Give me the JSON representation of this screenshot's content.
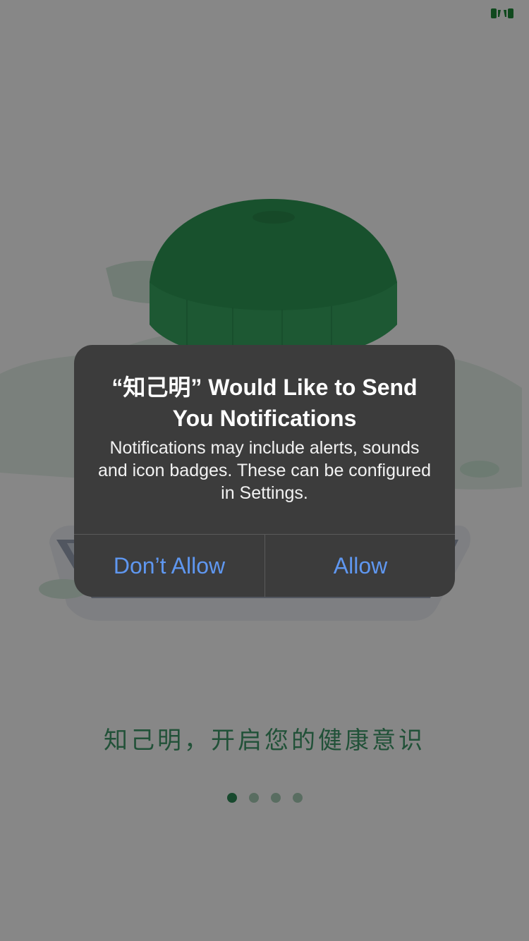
{
  "onboarding": {
    "tagline": "知己明，开启您的健康意识",
    "page_count": 4,
    "active_page": 1
  },
  "alert": {
    "title": "“知己明” Would Like to Send You Notifications",
    "message": "Notifications may include alerts, sounds and icon badges. These can be configured in Settings.",
    "dont_allow_label": "Don’t Allow",
    "allow_label": "Allow"
  },
  "colors": {
    "brand_green": "#2f8a57",
    "alert_background": "#3c3c3c",
    "alert_button_text": "#5f97f0"
  }
}
